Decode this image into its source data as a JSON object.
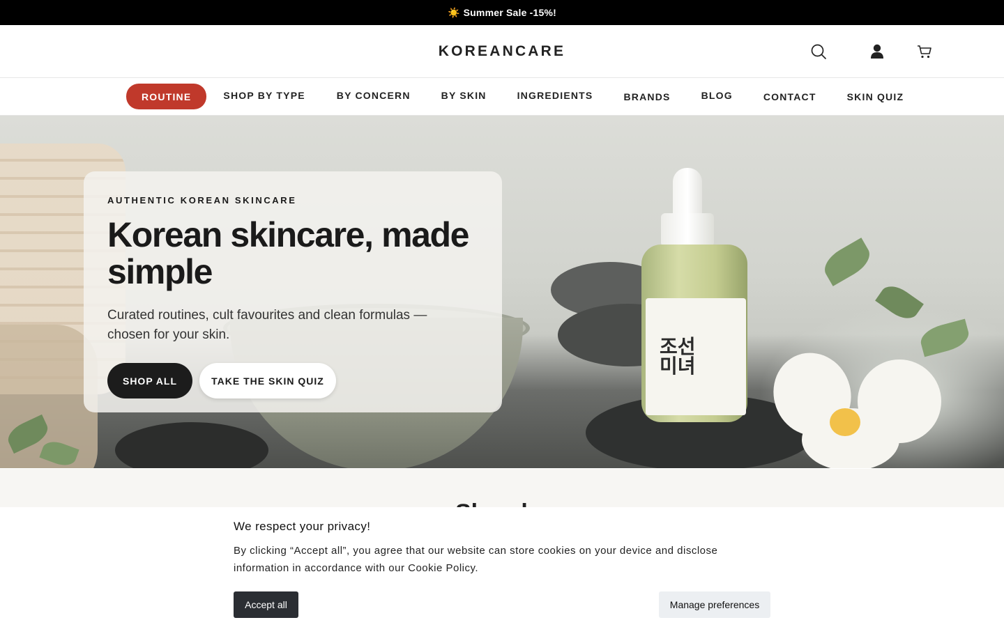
{
  "announcement": {
    "icon": "sun-icon",
    "sun_glyph": "☀️",
    "text": "Summer Sale -15%!"
  },
  "header": {
    "logo": "KOREANCARE",
    "icons": [
      "search-icon",
      "account-icon",
      "cart-icon"
    ]
  },
  "nav": {
    "items": [
      "ROUTINE",
      "SHOP BY TYPE",
      "BY CONCERN",
      "BY SKIN",
      "INGREDIENTS",
      "BRANDS",
      "BLOG",
      "CONTACT",
      "SKIN QUIZ"
    ],
    "active_index": 0
  },
  "hero": {
    "eyebrow": "AUTHENTIC KOREAN SKINCARE",
    "title": "Korean skincare, made simple",
    "subtitle": "Curated routines, cult favourites and clean formulas — chosen for your skin.",
    "primary_cta": "SHOP ALL",
    "secondary_cta": "TAKE THE SKIN QUIZ",
    "bottle_label": "조선미녀"
  },
  "section": {
    "heading": "Shop by"
  },
  "cookie": {
    "title": "We respect your privacy!",
    "text": "By clicking “Accept all”, you agree that our website can store cookies on your device and disclose information in accordance with our Cookie Policy.",
    "accept": "Accept all",
    "manage": "Manage preferences"
  },
  "colors": {
    "accent": "#c0392b",
    "announce_bg": "#000000",
    "primary_button": "#1c1c1c",
    "cookie_accept": "#2b2e33"
  }
}
